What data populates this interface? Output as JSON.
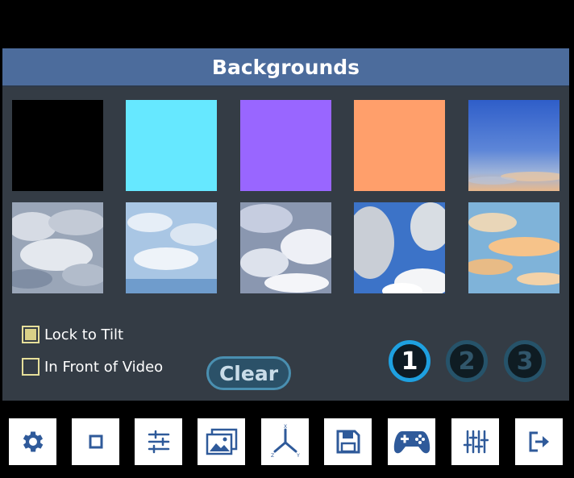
{
  "panel": {
    "title": "Backgrounds",
    "tiles": [
      {
        "name": "black",
        "kind": "solid",
        "color": "#000000"
      },
      {
        "name": "cyan",
        "kind": "solid",
        "color": "#66e8ff"
      },
      {
        "name": "purple",
        "kind": "solid",
        "color": "#9966ff"
      },
      {
        "name": "orange",
        "kind": "solid",
        "color": "#ff9f6b"
      },
      {
        "name": "blue-sky-sunset",
        "kind": "image"
      },
      {
        "name": "grey-clouds",
        "kind": "image"
      },
      {
        "name": "light-blue-clouds",
        "kind": "image"
      },
      {
        "name": "overcast-clouds",
        "kind": "image"
      },
      {
        "name": "cumulus-blue-sky",
        "kind": "image"
      },
      {
        "name": "golden-sunset-clouds",
        "kind": "image"
      }
    ]
  },
  "options": {
    "lock_to_tilt": {
      "label": "Lock to Tilt",
      "checked": true
    },
    "in_front_of_video": {
      "label": "In Front of Video",
      "checked": false
    }
  },
  "clear_label": "Clear",
  "pages": [
    {
      "label": "1",
      "active": true
    },
    {
      "label": "2",
      "active": false
    },
    {
      "label": "3",
      "active": false
    }
  ],
  "toolbar": [
    {
      "icon": "gear-icon"
    },
    {
      "icon": "square-icon"
    },
    {
      "icon": "sliders-icon"
    },
    {
      "icon": "gallery-icon"
    },
    {
      "icon": "axes-icon",
      "labels": [
        "X",
        "Z",
        "Y"
      ]
    },
    {
      "icon": "save-icon"
    },
    {
      "icon": "gamepad-icon"
    },
    {
      "icon": "mixer-icon"
    },
    {
      "icon": "exit-icon"
    }
  ],
  "colors": {
    "header": "#4c6c9c",
    "panel": "#343c45",
    "accent": "#1ea0e0",
    "checkbox": "#e6df9a"
  }
}
